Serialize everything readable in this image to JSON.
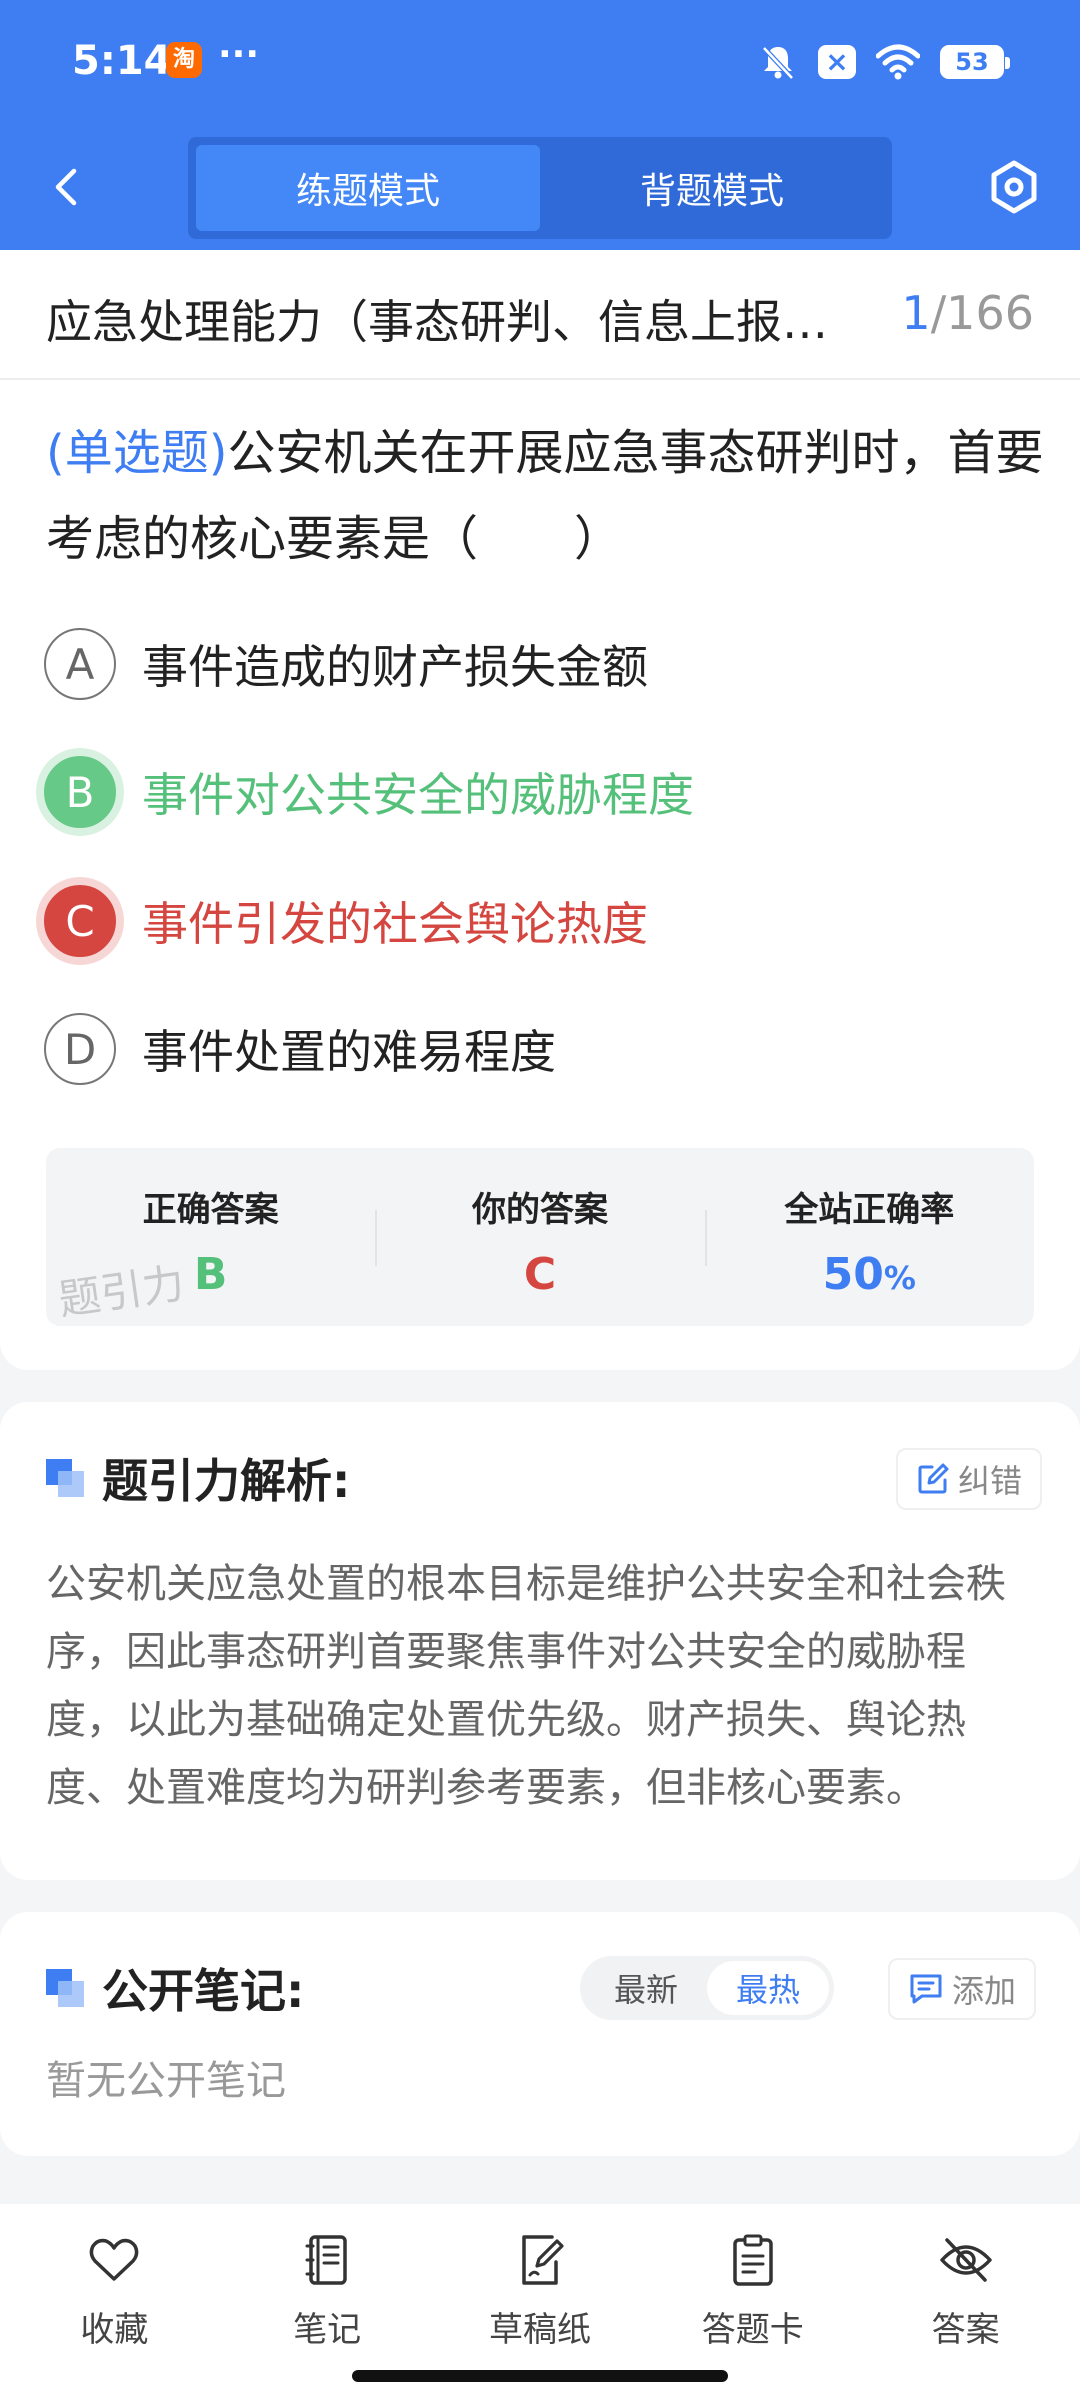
{
  "status_bar": {
    "time": "5:14",
    "app_badge": "淘",
    "more": "···",
    "battery": "53"
  },
  "header": {
    "tabs": [
      "练题模式",
      "背题模式"
    ],
    "active_tab": 0,
    "accent_color": "#3f7ef2"
  },
  "question": {
    "section_title": "应急处理能力（事态研判、信息上报…",
    "current": "1",
    "total": "/166",
    "type_tag": "(单选题)",
    "stem": "公安机关在开展应急事态研判时，首要考虑的核心要素是（　　）",
    "options": [
      {
        "letter": "A",
        "text": "事件造成的财产损失金额",
        "state": "normal"
      },
      {
        "letter": "B",
        "text": "事件对公共安全的威胁程度",
        "state": "correct"
      },
      {
        "letter": "C",
        "text": "事件引发的社会舆论热度",
        "state": "wrong"
      },
      {
        "letter": "D",
        "text": "事件处置的难易程度",
        "state": "normal"
      }
    ],
    "result": {
      "correct_label": "正确答案",
      "correct_value": "B",
      "yours_label": "你的答案",
      "yours_value": "C",
      "rate_label": "全站正确率",
      "rate_value": "50",
      "rate_unit": "%"
    },
    "watermark": "题引力"
  },
  "analysis": {
    "title": "题引力解析:",
    "report_label": "纠错",
    "text": "公安机关应急处置的根本目标是维护公共安全和社会秩序，因此事态研判首要聚焦事件对公共安全的威胁程度，以此为基础确定处置优先级。财产损失、舆论热度、处置难度均为研判参考要素，但非核心要素。"
  },
  "notes": {
    "title": "公开笔记:",
    "sort_options": [
      "最新",
      "最热"
    ],
    "active_sort": 1,
    "add_label": "添加",
    "empty_text": "暂无公开笔记"
  },
  "bottom_bar": {
    "items": [
      {
        "label": "收藏",
        "icon": "heart-icon"
      },
      {
        "label": "笔记",
        "icon": "notebook-icon"
      },
      {
        "label": "草稿纸",
        "icon": "draft-pen-icon"
      },
      {
        "label": "答题卡",
        "icon": "clipboard-icon"
      },
      {
        "label": "答案",
        "icon": "eye-off-icon"
      }
    ]
  }
}
